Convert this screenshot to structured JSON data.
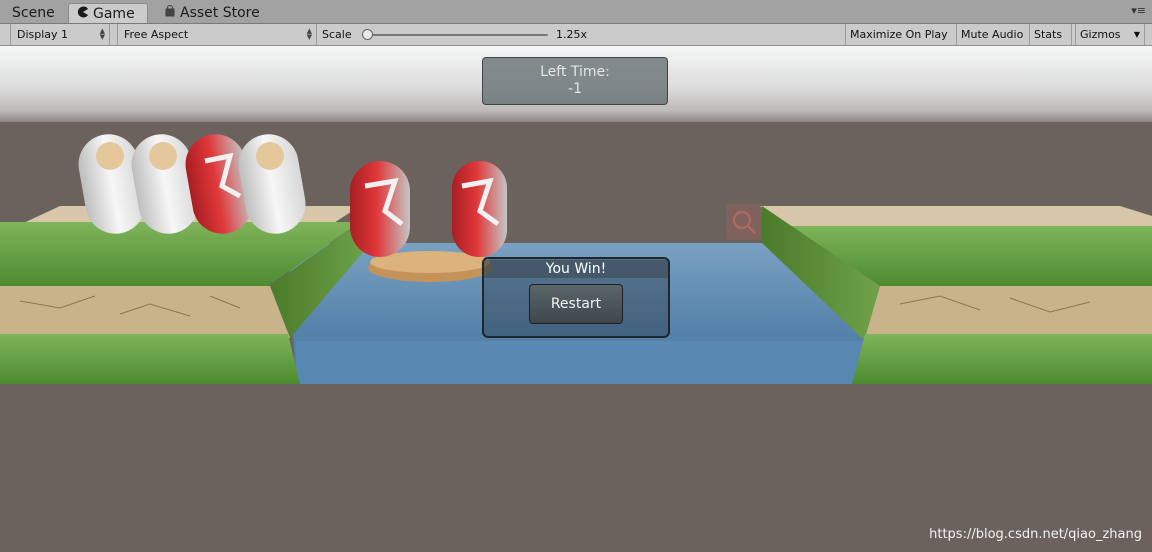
{
  "tabs": [
    {
      "label": "Scene",
      "icon": "scene-icon"
    },
    {
      "label": "Game",
      "icon": "pacman-icon"
    },
    {
      "label": "Asset Store",
      "icon": "store-bag-icon"
    }
  ],
  "toolbar": {
    "display": "Display 1",
    "aspect": "Free Aspect",
    "scale_label": "Scale",
    "scale_value": "1.25x",
    "maximize_on_play": "Maximize On Play",
    "mute_audio": "Mute Audio",
    "stats": "Stats",
    "gizmos": "Gizmos"
  },
  "hud": {
    "time_label": "Left Time:",
    "time_value": "-1"
  },
  "win_dialog": {
    "title": "You Win!",
    "restart_label": "Restart"
  },
  "watermark": "https://blog.csdn.net/qiao_zhang",
  "colors": {
    "background": "#6b625e",
    "water": "#5f88ad",
    "grass": "#5c9a3c",
    "dirt": "#c6ae82",
    "devil_red": "#c8272b",
    "priest_white": "#eeeeee"
  }
}
